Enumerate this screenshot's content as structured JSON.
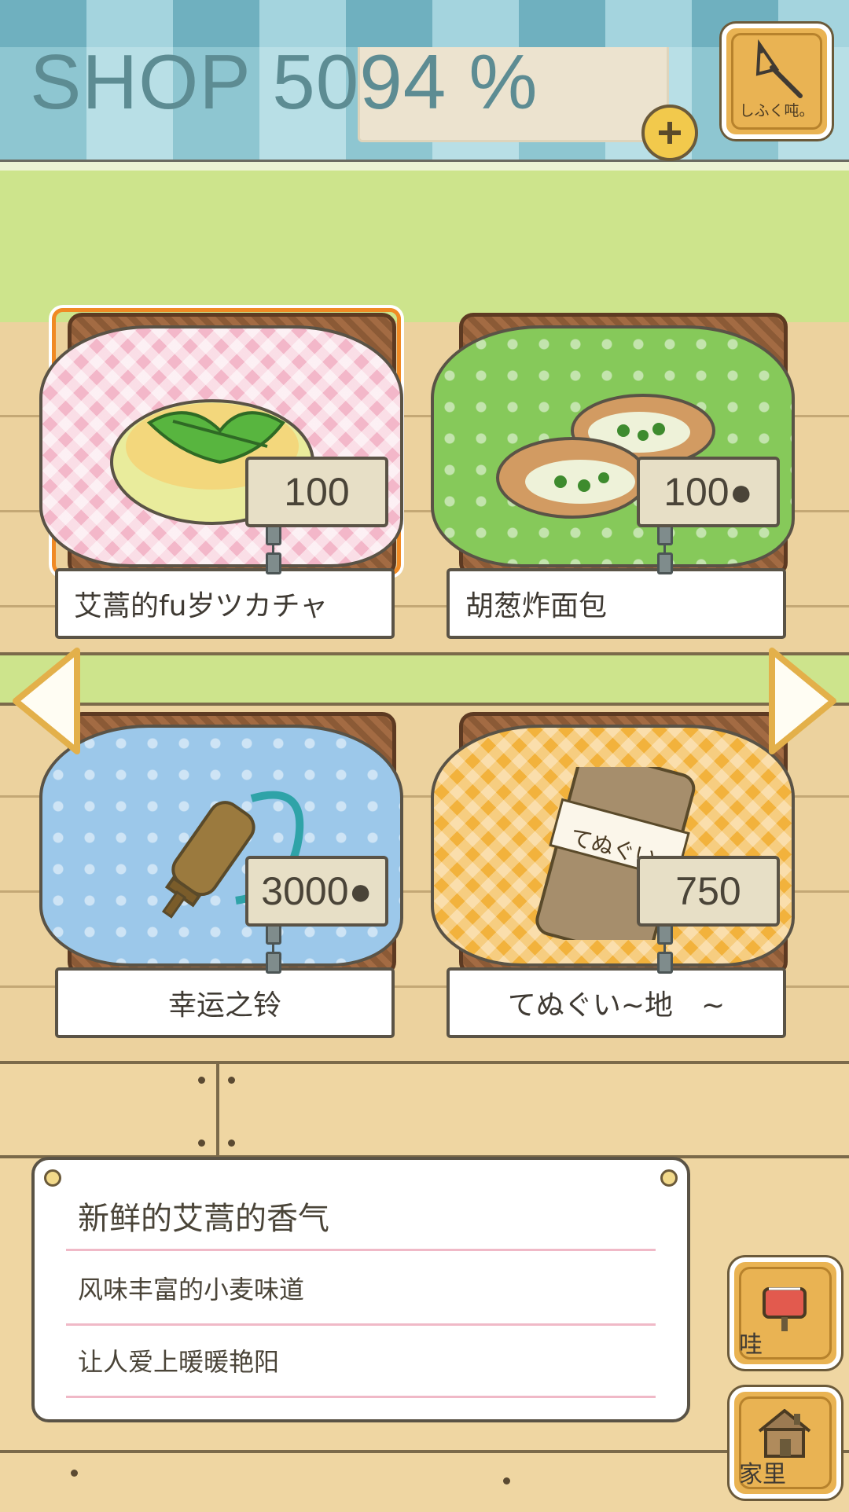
{
  "header": {
    "title": "SHOP 5094 %",
    "add_coins_icon": "plus-coin-icon",
    "collect_button": {
      "label": "しふく吨。",
      "icon": "bell-net-icon"
    }
  },
  "products": [
    {
      "name": "艾蒿的fu岁ツカチャ",
      "price": "100",
      "cloth_color": "#f3b7c9",
      "selected": true,
      "icon": "mugwort-pancake-icon"
    },
    {
      "name": "胡葱炸面包",
      "price": "100●",
      "cloth_color": "#86c95a",
      "selected": false,
      "icon": "scallion-bread-icon"
    },
    {
      "name": "幸运之铃",
      "price": "3000●",
      "cloth_color": "#9cc8ea",
      "selected": false,
      "icon": "lucky-bell-icon"
    },
    {
      "name": "てぬぐい~地　~",
      "price": "750",
      "cloth_color": "#f2b23c",
      "selected": false,
      "icon": "tenugui-towel-icon",
      "towel_text": "てぬぐい"
    }
  ],
  "navigation": {
    "prev_icon": "arrow-left-icon",
    "next_icon": "arrow-right-icon"
  },
  "description": {
    "title": "新鲜的艾蒿的香气",
    "line1": "风味丰富的小麦味道",
    "line2": "让人爱上暖暖艳阳"
  },
  "side_buttons": [
    {
      "label": "哇",
      "icon": "mailbox-icon"
    },
    {
      "label": "家里",
      "icon": "house-icon"
    }
  ],
  "colors": {
    "accent_selected": "#f08a24",
    "button_gold": "#e9b353",
    "wall_green": "#cde48c"
  }
}
